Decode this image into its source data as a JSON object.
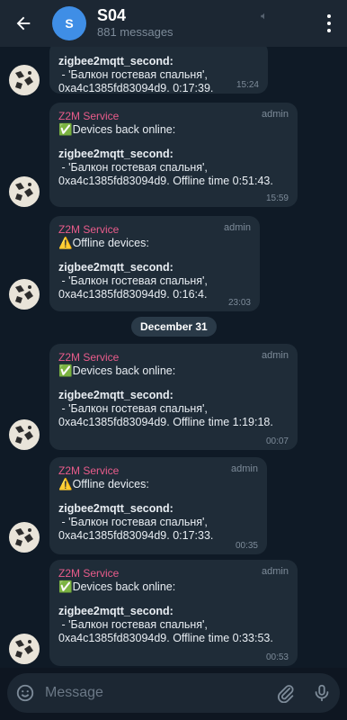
{
  "header": {
    "title": "S04",
    "subtitle": "881 messages",
    "avatar_letter": "S"
  },
  "messages": [
    {
      "sender": "",
      "admin": "",
      "lines": [
        "zigbee2mqtt_second:",
        " - 'Балкон гостевая спальня',",
        "0xa4c1385fd83094d9. 0:17:39."
      ],
      "time": "15:24"
    },
    {
      "sender": "Z2M Service",
      "admin": "admin",
      "heading": "✅Devices back online:",
      "lines": [
        "zigbee2mqtt_second:",
        " - 'Балкон гостевая спальня',",
        "0xa4c1385fd83094d9. Offline time 0:51:43."
      ],
      "time": "15:59"
    },
    {
      "sender": "Z2M Service",
      "admin": "admin",
      "heading": "⚠️Offline devices:",
      "lines": [
        "zigbee2mqtt_second:",
        " - 'Балкон гостевая спальня',",
        "0xa4c1385fd83094d9. 0:16:4."
      ],
      "time": "23:03"
    },
    {
      "sender": "Z2M Service",
      "admin": "admin",
      "heading": "✅Devices back online:",
      "lines": [
        "zigbee2mqtt_second:",
        " - 'Балкон гостевая спальня',",
        "0xa4c1385fd83094d9. Offline time 1:19:18."
      ],
      "time": "00:07"
    },
    {
      "sender": "Z2M Service",
      "admin": "admin",
      "heading": "⚠️Offline devices:",
      "lines": [
        "zigbee2mqtt_second:",
        " - 'Балкон гостевая спальня',",
        "0xa4c1385fd83094d9. 0:17:33."
      ],
      "time": "00:35"
    },
    {
      "sender": "Z2M Service",
      "admin": "admin",
      "heading": "✅Devices back online:",
      "lines": [
        "zigbee2mqtt_second:",
        " - 'Балкон гостевая спальня',",
        "0xa4c1385fd83094d9. Offline time 0:33:53."
      ],
      "time": "00:53"
    }
  ],
  "date_separator": "December 31",
  "composer": {
    "placeholder": "Message"
  },
  "icons": {
    "back": "arrow-left-icon",
    "mute": "muted-speaker-icon",
    "menu": "more-vertical-icon",
    "emoji": "smiley-icon",
    "attach": "paperclip-icon",
    "mic": "microphone-icon"
  }
}
